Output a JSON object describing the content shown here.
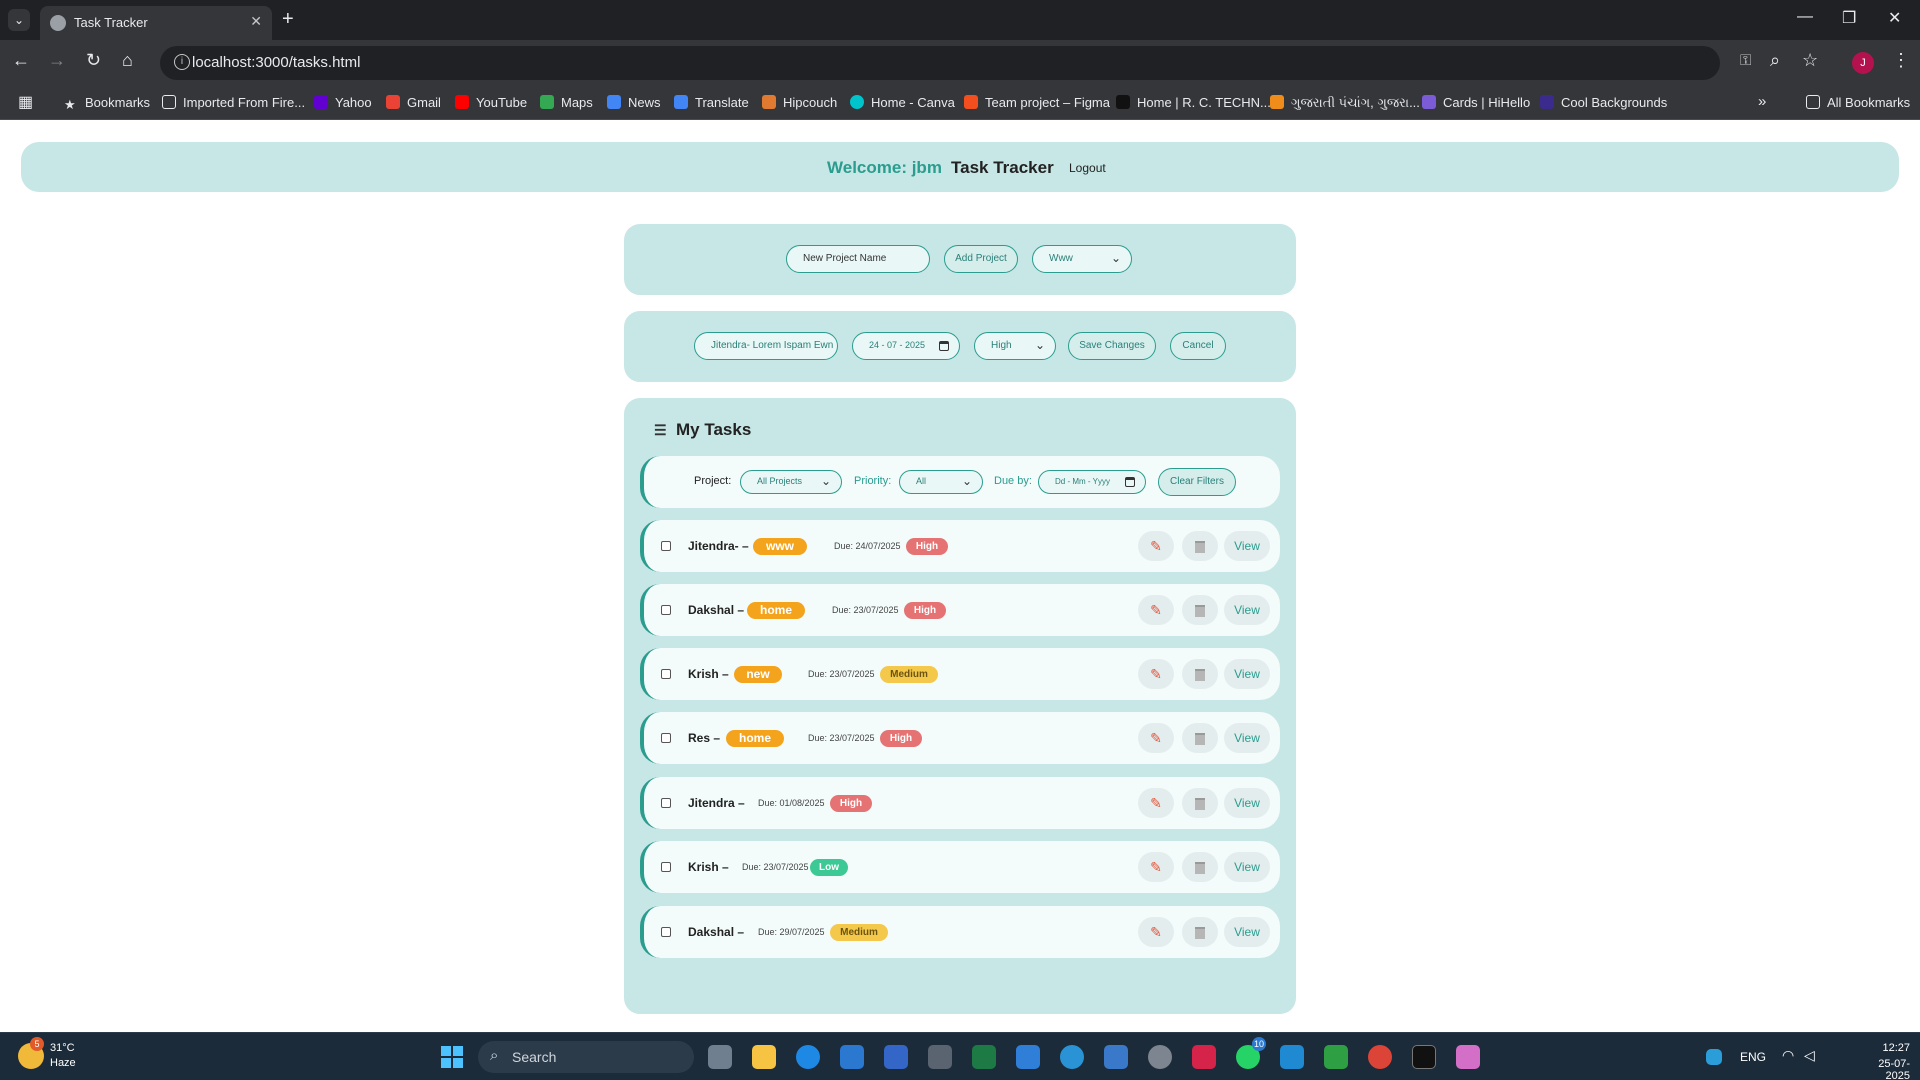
{
  "browser": {
    "tab_title": "Task Tracker",
    "url": "localhost:3000/tasks.html",
    "profile_initial": "J",
    "bookmarks": [
      "Bookmarks",
      "Imported From Fire...",
      "Yahoo",
      "Gmail",
      "YouTube",
      "Maps",
      "News",
      "Translate",
      "Hipcouch",
      "Home - Canva",
      "Team project – Figma",
      "Home | R. C. TECHN...",
      "ગુજરાતી પંચાંગ, ગુજરા...",
      "Cards | HiHello",
      "Cool Backgrounds"
    ],
    "all_bookmarks": "All Bookmarks"
  },
  "header": {
    "welcome": "Welcome: jbm",
    "title": "Task Tracker",
    "logout": "Logout"
  },
  "project_form": {
    "placeholder": "New Project Name",
    "add_button": "Add Project",
    "selected_project": "Www"
  },
  "edit_form": {
    "task_text": "Jitendra- Lorem Ispam Ewn",
    "date": "24 - 07 - 2025",
    "priority": "High",
    "save_button": "Save Changes",
    "cancel_button": "Cancel"
  },
  "tasks_section": {
    "title": "My Tasks",
    "filters": {
      "project_label": "Project:",
      "project_value": "All Projects",
      "priority_label": "Priority:",
      "priority_value": "All",
      "due_label": "Due by:",
      "due_value": "Dd - Mm - Yyyy",
      "clear_button": "Clear Filters"
    },
    "edit_icon": "pencil-icon",
    "delete_icon": "trash-icon",
    "view_label": "View",
    "tasks": [
      {
        "name": "Jitendra- –",
        "project": "www",
        "due": "Due: 24/07/2025",
        "priority": "High"
      },
      {
        "name": "Dakshal –",
        "project": "home",
        "due": "Due: 23/07/2025",
        "priority": "High"
      },
      {
        "name": "Krish –",
        "project": "new",
        "due": "Due: 23/07/2025",
        "priority": "Medium"
      },
      {
        "name": "Res –",
        "project": "home",
        "due": "Due: 23/07/2025",
        "priority": "High"
      },
      {
        "name": "Jitendra –",
        "project": "",
        "due": "Due: 01/08/2025",
        "priority": "High"
      },
      {
        "name": "Krish –",
        "project": "",
        "due": "Due: 23/07/2025",
        "priority": "Low"
      },
      {
        "name": "Dakshal –",
        "project": "",
        "due": "Due: 29/07/2025",
        "priority": "Medium"
      }
    ]
  },
  "colors": {
    "accent": "#2a9d8f",
    "card_bg": "#c7e6e6",
    "project_badge": "#f4a41c",
    "high": "#e57373",
    "medium": "#f4c84a",
    "low": "#3cc995"
  },
  "taskbar": {
    "weather_temp": "31°C",
    "weather_desc": "Haze",
    "weather_badge": "5",
    "search": "Search",
    "whatsapp_badge": "10",
    "language": "ENG",
    "time": "12:27",
    "date": "25-07-2025"
  }
}
